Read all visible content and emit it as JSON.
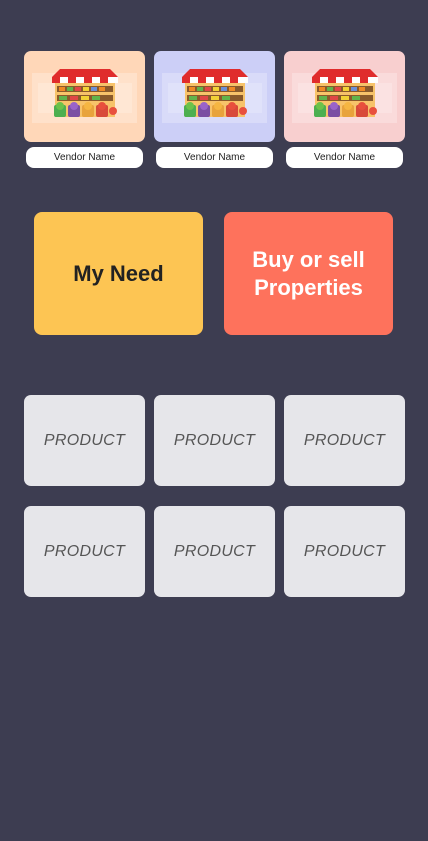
{
  "vendors": [
    {
      "name": "Vendor Name",
      "icon": "market-stall-icon",
      "tint": "#ffd7b8"
    },
    {
      "name": "Vendor Name",
      "icon": "market-stall-icon",
      "tint": "#cccff7"
    },
    {
      "name": "Vendor Name",
      "icon": "market-stall-icon",
      "tint": "#f8cfcf"
    }
  ],
  "actions": {
    "my_need_label": "My Need",
    "properties_label": "Buy or sell Properties",
    "colors": {
      "my_need": "#fdc553",
      "properties": "#fe725c"
    }
  },
  "products": [
    {
      "label": "PRODUCT"
    },
    {
      "label": "PRODUCT"
    },
    {
      "label": "PRODUCT"
    },
    {
      "label": "PRODUCT"
    },
    {
      "label": "PRODUCT"
    },
    {
      "label": "PRODUCT"
    }
  ],
  "theme": {
    "background": "#3d3d51",
    "product_card": "#e6e6ea"
  }
}
